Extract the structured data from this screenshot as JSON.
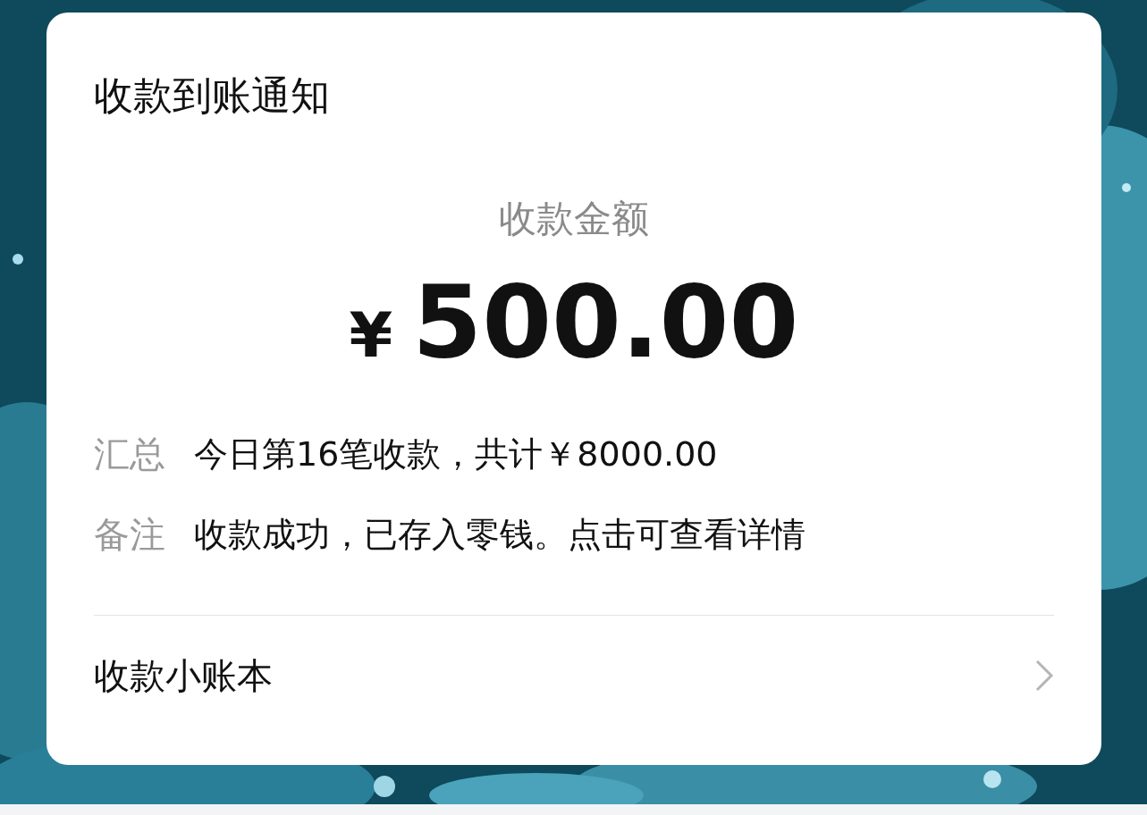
{
  "card": {
    "title": "收款到账通知",
    "amount_label": "收款金额",
    "currency": "¥",
    "amount": "500.00",
    "details": [
      {
        "label": "汇总",
        "value": "今日第16笔收款，共计￥8000.00"
      },
      {
        "label": "备注",
        "value": "收款成功，已存入零钱。点击可查看详情"
      }
    ],
    "link": {
      "label": "收款小账本"
    }
  }
}
